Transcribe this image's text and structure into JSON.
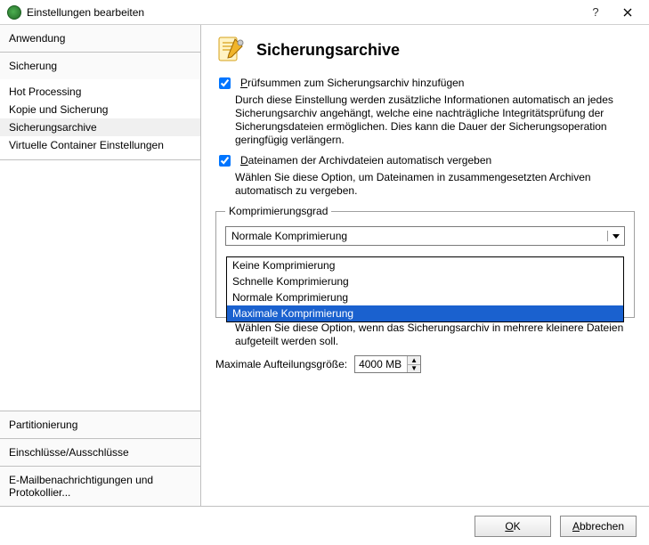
{
  "titlebar": {
    "title": "Einstellungen bearbeiten"
  },
  "sidebar": {
    "sections": [
      {
        "label": "Anwendung"
      },
      {
        "label": "Sicherung",
        "items": [
          "Hot Processing",
          "Kopie und Sicherung",
          "Sicherungsarchive",
          "Virtuelle Container Einstellungen"
        ],
        "selected_index": 2
      }
    ],
    "footer": [
      "Partitionierung",
      "Einschlüsse/Ausschlüsse",
      "E-Mailbenachrichtigungen und Protokollier..."
    ]
  },
  "content": {
    "heading": "Sicherungsarchive",
    "opt_checksum": {
      "checked": true,
      "label_prefix": "P",
      "label_rest": "rüfsummen zum Sicherungsarchiv hinzufügen",
      "desc": "Durch diese Einstellung werden zusätzliche Informationen automatisch an jedes Sicherungsarchiv angehängt, welche eine nachträgliche Integritätsprüfung der Sicherungsdateien ermöglichen. Dies kann die Dauer der Sicherungsoperation geringfügig verlängern."
    },
    "opt_autoname": {
      "checked": true,
      "label_prefix": "D",
      "label_rest": "ateinamen der Archivdateien automatisch vergeben",
      "desc": "Wählen Sie diese Option, um Dateinamen in zusammengesetzten Archiven automatisch zu vergeben."
    },
    "group_compression": {
      "legend_prefix": "K",
      "legend_rest": "omprimierungsgrad",
      "combo_value": "Normale Komprimierung",
      "options": [
        "Keine Komprimierung",
        "Schnelle Komprimierung",
        "Normale Komprimierung",
        "Maximale Komprimierung"
      ],
      "highlight_index": 3
    },
    "opt_split_desc": "Wählen Sie diese Option, wenn das Sicherungsarchiv in mehrere kleinere Dateien aufgeteilt werden soll.",
    "split_label_prefix": "Ma",
    "split_label_ul": "x",
    "split_label_rest": "imale Aufteilungsgröße:",
    "split_value": "4000 MB"
  },
  "buttons": {
    "ok_ul": "O",
    "ok_rest": "K",
    "cancel_ul": "A",
    "cancel_rest": "bbrechen"
  }
}
